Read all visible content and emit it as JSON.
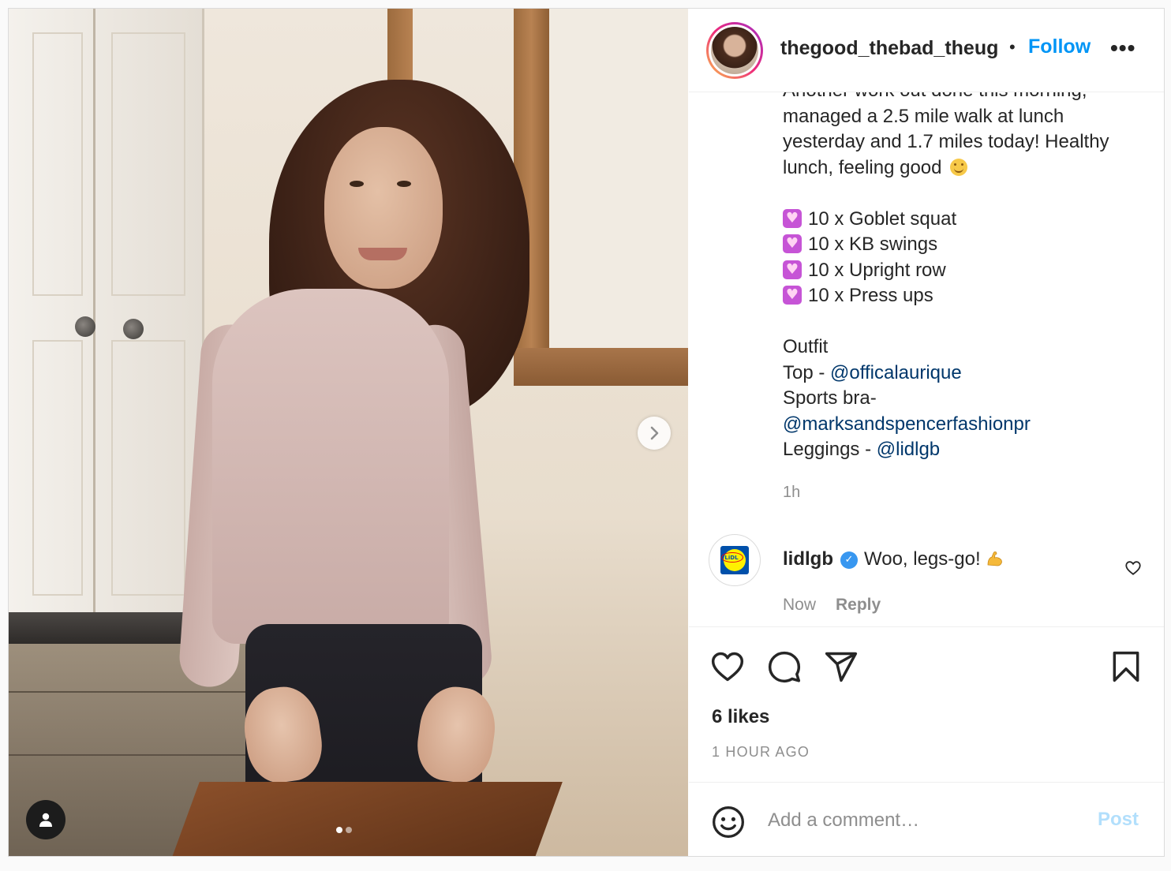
{
  "post": {
    "username": "thegood_thebad_theug",
    "follow_label": "Follow",
    "separator": "•",
    "more_label": "•••",
    "caption": {
      "cut_line": "Another work out done this morning,",
      "line1": "managed a 2.5 mile walk at lunch",
      "line2": "yesterday and 1.7 miles today! Healthy",
      "line3": "lunch, feeling good",
      "exercises": [
        "10 x Goblet squat",
        "10 x KB swings",
        "10 x Upright row",
        "10 x Press ups"
      ],
      "outfit_label": "Outfit",
      "top_label": "Top - ",
      "top_mention": "@officalaurique",
      "bra_label": "Sports bra-",
      "bra_mention": "@marksandspencerfashionpr",
      "leggings_label": "Leggings - ",
      "leggings_mention": "@lidlgb"
    },
    "time_ago": "1h",
    "carousel": {
      "count": 2,
      "active_index": 0
    }
  },
  "comment": {
    "username": "lidlgb",
    "verified": true,
    "text": "Woo, legs-go!",
    "time": "Now",
    "reply_label": "Reply",
    "avatar_logo": "LiDL"
  },
  "actions": {
    "likes": "6 likes",
    "posted": "1 HOUR AGO"
  },
  "add_comment": {
    "placeholder": "Add a comment…",
    "post_label": "Post"
  },
  "colors": {
    "link_blue": "#0095f6",
    "mention": "#00376b",
    "muted": "#8e8e8e",
    "post_disabled": "#b2dffc"
  },
  "icons": [
    "chevron-right-icon",
    "user-tag-icon",
    "heart-icon",
    "comment-icon",
    "share-icon",
    "bookmark-icon",
    "emoji-icon",
    "verified-icon",
    "flexed-biceps-emoji",
    "purple-heart-emoji",
    "smiling-face-emoji"
  ]
}
